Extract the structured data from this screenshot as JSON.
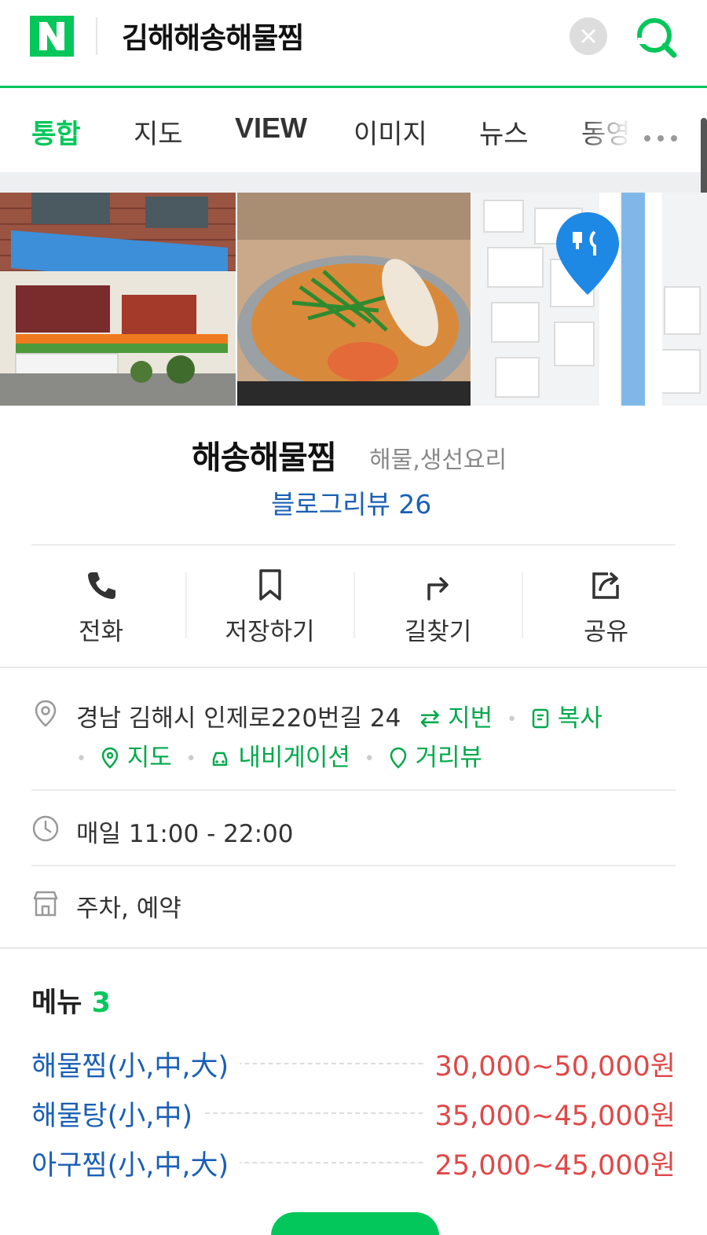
{
  "header": {
    "logo_letter": "N",
    "query": "김해해송해물찜",
    "brand_color": "#03c75a"
  },
  "tabs": [
    {
      "label": "통합",
      "active": true
    },
    {
      "label": "지도"
    },
    {
      "label": "VIEW"
    },
    {
      "label": "이미지"
    },
    {
      "label": "뉴스"
    },
    {
      "label": "동영"
    }
  ],
  "place": {
    "name": "해송해물찜",
    "category": "해물,생선요리",
    "blog_review": "블로그리뷰 26"
  },
  "actions": [
    {
      "label": "전화",
      "icon": "phone-icon"
    },
    {
      "label": "저장하기",
      "icon": "bookmark-icon"
    },
    {
      "label": "길찾기",
      "icon": "directions-icon"
    },
    {
      "label": "공유",
      "icon": "share-icon"
    }
  ],
  "info": {
    "address": "경남 김해시 인제로220번길 24",
    "address_links": {
      "jibun": "지번",
      "copy": "복사",
      "map": "지도",
      "navigation": "내비게이션",
      "street_view": "거리뷰"
    },
    "hours": "매일 11:00 - 22:00",
    "amenities": "주차, 예약"
  },
  "menu": {
    "title": "메뉴",
    "count": "3",
    "items": [
      {
        "name": "해물찜(小,中,大)",
        "price": "30,000~50,000원"
      },
      {
        "name": "해물탕(小,中)",
        "price": "35,000~45,000원"
      },
      {
        "name": "아구찜(小,中,大)",
        "price": "25,000~45,000원"
      }
    ]
  },
  "colors": {
    "green": "#03c75a",
    "link_blue": "#1a5fb4",
    "price_red": "#e04848"
  }
}
